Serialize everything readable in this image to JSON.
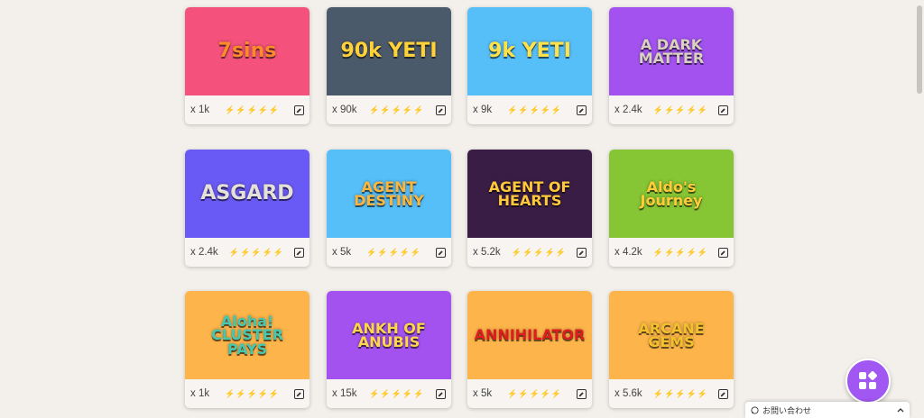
{
  "games": [
    {
      "logo": "7sins",
      "multiplier": "x 1k",
      "volatility": 4,
      "bg": "#f4527c",
      "fg": "#ff8a2b"
    },
    {
      "logo": "90k YETI",
      "multiplier": "x 90k",
      "volatility": 5,
      "bg": "#4b5a6a",
      "fg": "#ffd23a"
    },
    {
      "logo": "9k YETI",
      "multiplier": "x 9k",
      "volatility": 5,
      "bg": "#56bff7",
      "fg": "#ffe24a"
    },
    {
      "logo": "A DARK MATTER",
      "multiplier": "x 2.4k",
      "volatility": 5,
      "bg": "#a352f0",
      "fg": "#d8d2bf"
    },
    {
      "logo": "ASGARD",
      "multiplier": "x 2.4k",
      "volatility": 3,
      "bg": "#6a5af5",
      "fg": "#e5e0d8"
    },
    {
      "logo": "AGENT DESTINY",
      "multiplier": "x 5k",
      "volatility": 4,
      "bg": "#56bff7",
      "fg": "#ffb43a"
    },
    {
      "logo": "AGENT OF HEARTS",
      "multiplier": "x 5.2k",
      "volatility": 4,
      "bg": "#3a1d45",
      "fg": "#ffc93a"
    },
    {
      "logo": "Aldo's Journey",
      "multiplier": "x 4.2k",
      "volatility": 3,
      "bg": "#86c534",
      "fg": "#ffcc3a"
    },
    {
      "logo": "Aloha! CLUSTER PAYS",
      "multiplier": "x 1k",
      "volatility": 1,
      "bg": "#fdb44a",
      "fg": "#43c8b2"
    },
    {
      "logo": "ANKH OF ANUBIS",
      "multiplier": "x 15k",
      "volatility": 4,
      "bg": "#a352f0",
      "fg": "#ffd64a"
    },
    {
      "logo": "ANNIHILATOR",
      "multiplier": "x 5k",
      "volatility": 4,
      "bg": "#fdb44a",
      "fg": "#e01d1d"
    },
    {
      "logo": "ARCANE GEMS",
      "multiplier": "x 5.6k",
      "volatility": 3,
      "bg": "#fdb44a",
      "fg": "#f4c12e"
    }
  ],
  "contact_label": "お問い合わせ",
  "icons": {
    "info": "edit-icon",
    "fab": "apps-icon",
    "chat": "chat-icon",
    "collapse": "chevron-up-icon"
  }
}
